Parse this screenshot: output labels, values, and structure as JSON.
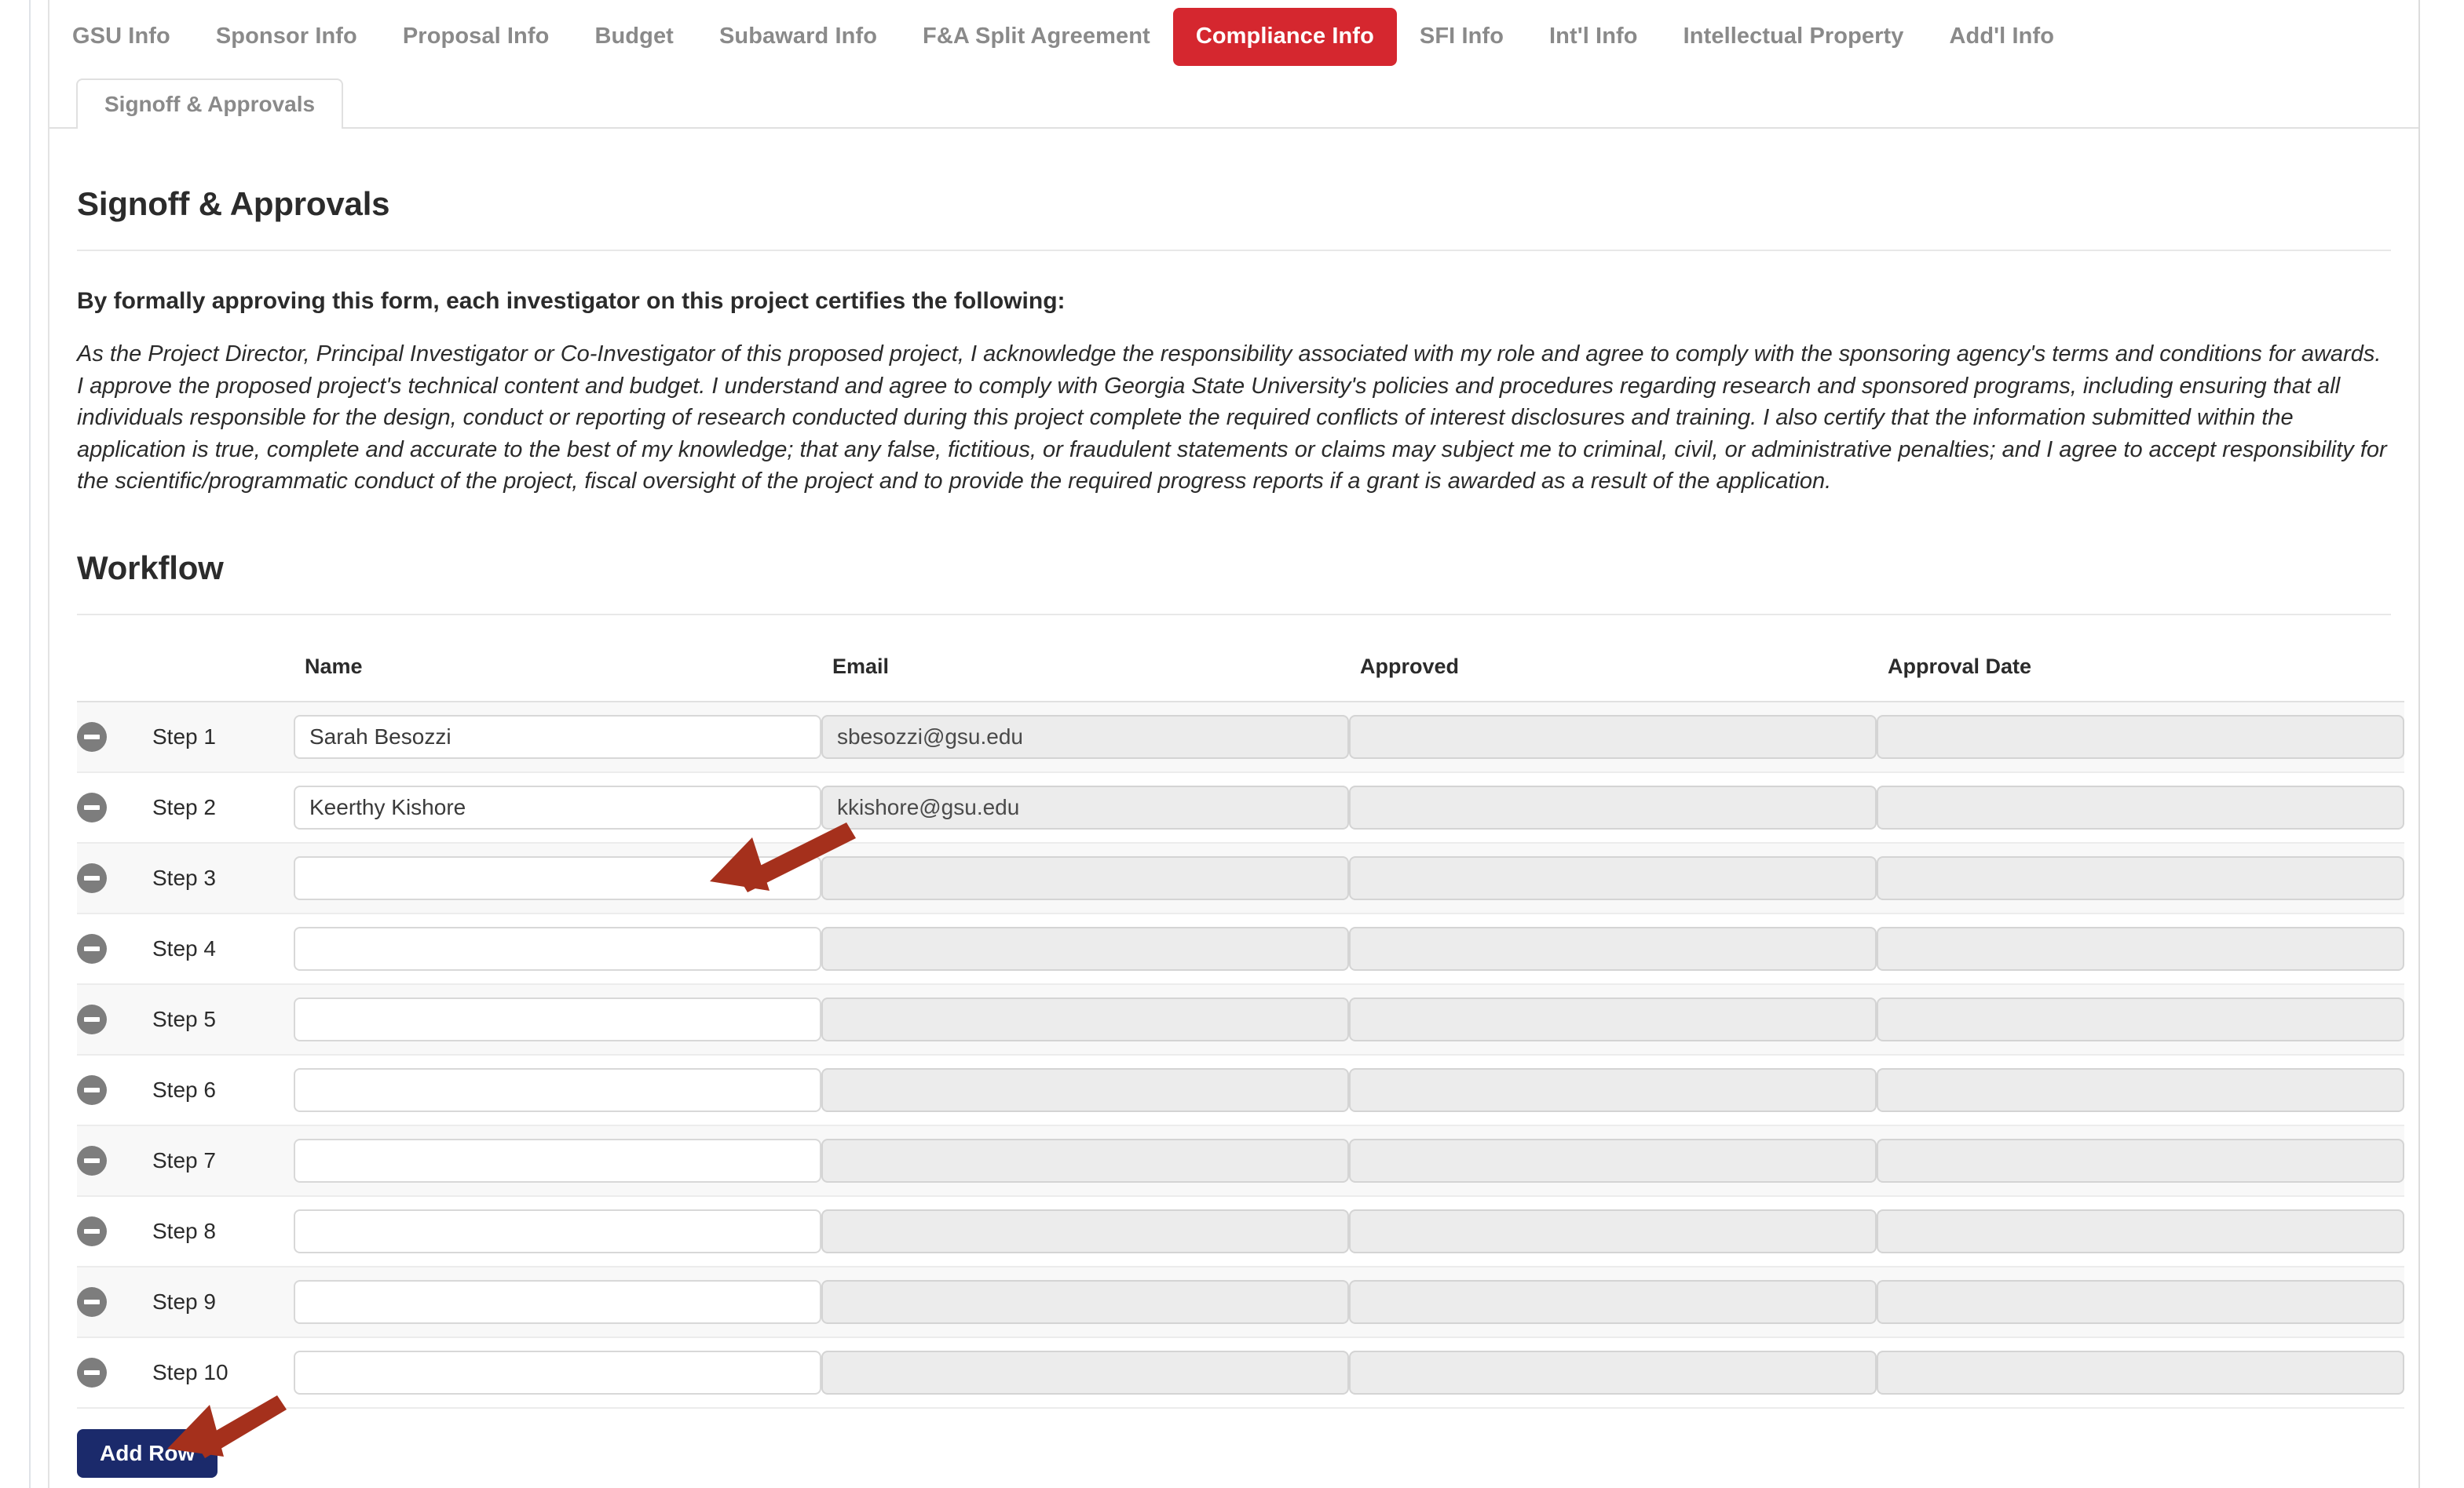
{
  "tabs": [
    {
      "label": "GSU Info",
      "active": false
    },
    {
      "label": "Sponsor Info",
      "active": false
    },
    {
      "label": "Proposal Info",
      "active": false
    },
    {
      "label": "Budget",
      "active": false
    },
    {
      "label": "Subaward Info",
      "active": false
    },
    {
      "label": "F&A Split Agreement",
      "active": false
    },
    {
      "label": "Compliance Info",
      "active": true
    },
    {
      "label": "SFI Info",
      "active": false
    },
    {
      "label": "Int'l Info",
      "active": false
    },
    {
      "label": "Intellectual Property",
      "active": false
    },
    {
      "label": "Add'l Info",
      "active": false
    }
  ],
  "subtab": {
    "label": "Signoff & Approvals"
  },
  "page": {
    "title": "Signoff & Approvals",
    "certification_heading": "By formally approving this form, each investigator on this project certifies the following:",
    "certification_body": "As the Project Director, Principal Investigator or Co-Investigator of this proposed project, I acknowledge the responsibility associated with my role and agree to comply with the sponsoring agency's terms and conditions for awards. I approve the proposed project's technical content and budget. I understand and agree to comply with Georgia State University's policies and procedures regarding research and sponsored programs, including ensuring that all individuals responsible for the design, conduct or reporting of research conducted during this project complete the required conflicts of interest disclosures and training. I also certify that the information submitted within the application is true, complete and accurate to the best of my knowledge; that any false, fictitious, or fraudulent statements or claims may subject me to criminal, civil, or administrative penalties; and I agree to accept responsibility for the scientific/programmatic conduct of the project, fiscal oversight of the project and to provide the required progress reports if a grant is awarded as a result of the application.",
    "workflow_title": "Workflow"
  },
  "workflow": {
    "columns": [
      "",
      "",
      "Name",
      "Email",
      "Approved",
      "Approval Date"
    ],
    "rows": [
      {
        "step": "Step 1",
        "name": "Sarah Besozzi",
        "email": "sbesozzi@gsu.edu",
        "approved": "",
        "approval_date": ""
      },
      {
        "step": "Step 2",
        "name": "Keerthy Kishore",
        "email": "kkishore@gsu.edu",
        "approved": "",
        "approval_date": ""
      },
      {
        "step": "Step 3",
        "name": "",
        "email": "",
        "approved": "",
        "approval_date": ""
      },
      {
        "step": "Step 4",
        "name": "",
        "email": "",
        "approved": "",
        "approval_date": ""
      },
      {
        "step": "Step 5",
        "name": "",
        "email": "",
        "approved": "",
        "approval_date": ""
      },
      {
        "step": "Step 6",
        "name": "",
        "email": "",
        "approved": "",
        "approval_date": ""
      },
      {
        "step": "Step 7",
        "name": "",
        "email": "",
        "approved": "",
        "approval_date": ""
      },
      {
        "step": "Step 8",
        "name": "",
        "email": "",
        "approved": "",
        "approval_date": ""
      },
      {
        "step": "Step 9",
        "name": "",
        "email": "",
        "approved": "",
        "approval_date": ""
      },
      {
        "step": "Step 10",
        "name": "",
        "email": "",
        "approved": "",
        "approval_date": ""
      }
    ],
    "add_row_label": "Add Row",
    "remove_icon": "minus-circle-icon"
  },
  "annotations": [
    {
      "name": "arrow-pointing-to-step3-name-field",
      "color": "#a5301c"
    },
    {
      "name": "arrow-pointing-to-add-row-button",
      "color": "#a5301c"
    }
  ],
  "colors": {
    "active_tab": "#d5272f",
    "add_row_button": "#1b2a6b",
    "annotation_arrow": "#a5301c",
    "row_stripe": "#f8f8f8",
    "disabled_field": "#ececec"
  }
}
